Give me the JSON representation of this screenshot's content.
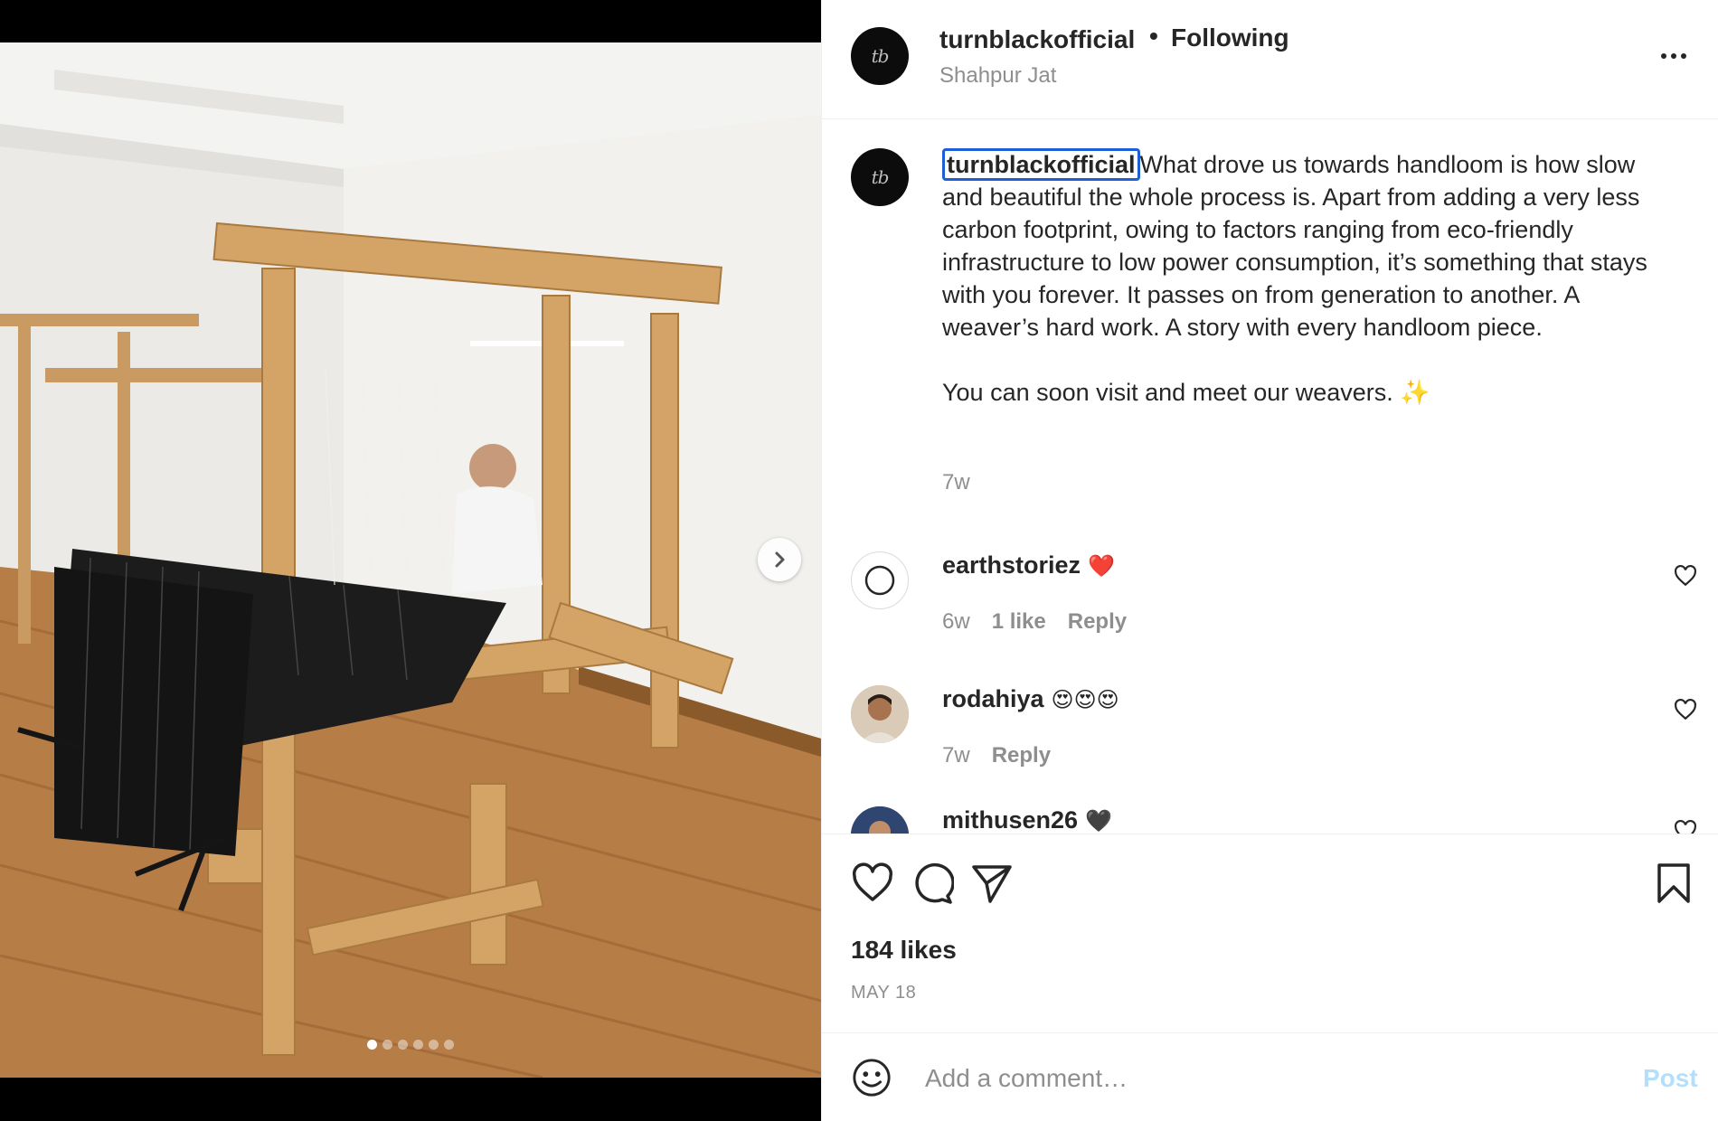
{
  "post": {
    "username": "turnblackofficial",
    "follow_status": "Following",
    "separator": "•",
    "location": "Shahpur Jat",
    "avatar_text": "tb",
    "more_icon": "more-horizontal-icon"
  },
  "caption": {
    "mention": "turnblackofficial",
    "paragraph1": "What drove us towards handloom is how slow and beautiful the whole process is. Apart from adding a very less carbon footprint, owing to factors ranging from eco-friendly infrastructure to low power consumption, it’s something that stays with you forever. It passes on from generation to another. A weaver’s hard work. A story with every handloom piece.",
    "paragraph2": "You can soon visit and meet our weavers. ✨",
    "time": "7w"
  },
  "comments": [
    {
      "username": "earthstoriez",
      "text": "❤️",
      "time": "6w",
      "likes": "1 like",
      "reply": "Reply"
    },
    {
      "username": "rodahiya",
      "text": "😍😍😍",
      "time": "7w",
      "likes": "",
      "reply": "Reply"
    },
    {
      "username": "mithusen26",
      "text": "🖤",
      "time": "",
      "likes": "",
      "reply": ""
    }
  ],
  "actions": {
    "likes": "184 likes",
    "date": "MAY 18"
  },
  "add_comment": {
    "placeholder": "Add a comment…",
    "post_label": "Post"
  },
  "carousel": {
    "slides": 6,
    "active": 1
  },
  "colors": {
    "mention_outline": "#1f5fd6",
    "secondary_text": "#8e8e8e",
    "post_button_disabled": "#b2dffc",
    "heart_red": "#ed4956"
  }
}
